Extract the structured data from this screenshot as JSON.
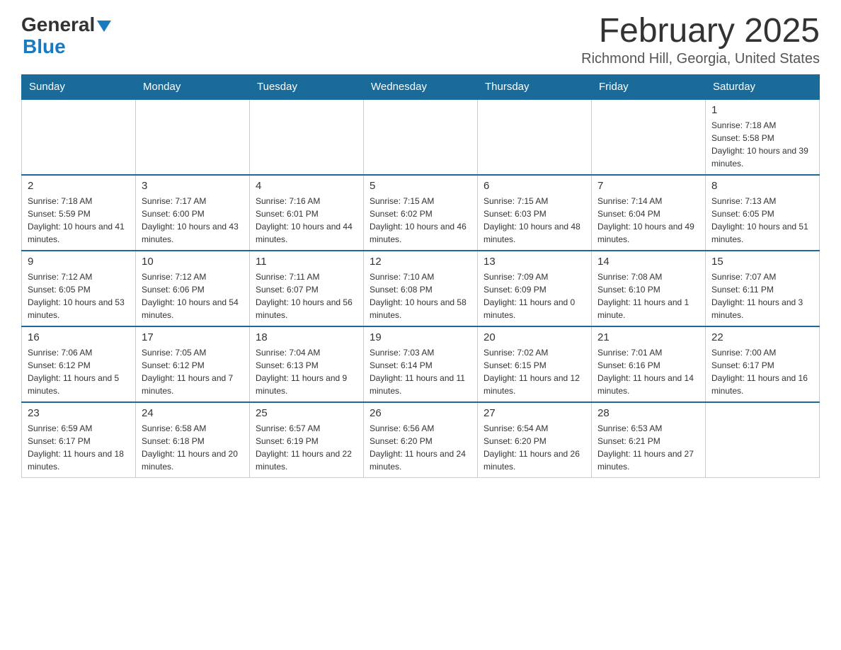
{
  "logo": {
    "general": "General",
    "blue": "Blue"
  },
  "title": {
    "month_year": "February 2025",
    "location": "Richmond Hill, Georgia, United States"
  },
  "days_of_week": [
    "Sunday",
    "Monday",
    "Tuesday",
    "Wednesday",
    "Thursday",
    "Friday",
    "Saturday"
  ],
  "weeks": [
    [
      {
        "day": "",
        "info": ""
      },
      {
        "day": "",
        "info": ""
      },
      {
        "day": "",
        "info": ""
      },
      {
        "day": "",
        "info": ""
      },
      {
        "day": "",
        "info": ""
      },
      {
        "day": "",
        "info": ""
      },
      {
        "day": "1",
        "info": "Sunrise: 7:18 AM\nSunset: 5:58 PM\nDaylight: 10 hours and 39 minutes."
      }
    ],
    [
      {
        "day": "2",
        "info": "Sunrise: 7:18 AM\nSunset: 5:59 PM\nDaylight: 10 hours and 41 minutes."
      },
      {
        "day": "3",
        "info": "Sunrise: 7:17 AM\nSunset: 6:00 PM\nDaylight: 10 hours and 43 minutes."
      },
      {
        "day": "4",
        "info": "Sunrise: 7:16 AM\nSunset: 6:01 PM\nDaylight: 10 hours and 44 minutes."
      },
      {
        "day": "5",
        "info": "Sunrise: 7:15 AM\nSunset: 6:02 PM\nDaylight: 10 hours and 46 minutes."
      },
      {
        "day": "6",
        "info": "Sunrise: 7:15 AM\nSunset: 6:03 PM\nDaylight: 10 hours and 48 minutes."
      },
      {
        "day": "7",
        "info": "Sunrise: 7:14 AM\nSunset: 6:04 PM\nDaylight: 10 hours and 49 minutes."
      },
      {
        "day": "8",
        "info": "Sunrise: 7:13 AM\nSunset: 6:05 PM\nDaylight: 10 hours and 51 minutes."
      }
    ],
    [
      {
        "day": "9",
        "info": "Sunrise: 7:12 AM\nSunset: 6:05 PM\nDaylight: 10 hours and 53 minutes."
      },
      {
        "day": "10",
        "info": "Sunrise: 7:12 AM\nSunset: 6:06 PM\nDaylight: 10 hours and 54 minutes."
      },
      {
        "day": "11",
        "info": "Sunrise: 7:11 AM\nSunset: 6:07 PM\nDaylight: 10 hours and 56 minutes."
      },
      {
        "day": "12",
        "info": "Sunrise: 7:10 AM\nSunset: 6:08 PM\nDaylight: 10 hours and 58 minutes."
      },
      {
        "day": "13",
        "info": "Sunrise: 7:09 AM\nSunset: 6:09 PM\nDaylight: 11 hours and 0 minutes."
      },
      {
        "day": "14",
        "info": "Sunrise: 7:08 AM\nSunset: 6:10 PM\nDaylight: 11 hours and 1 minute."
      },
      {
        "day": "15",
        "info": "Sunrise: 7:07 AM\nSunset: 6:11 PM\nDaylight: 11 hours and 3 minutes."
      }
    ],
    [
      {
        "day": "16",
        "info": "Sunrise: 7:06 AM\nSunset: 6:12 PM\nDaylight: 11 hours and 5 minutes."
      },
      {
        "day": "17",
        "info": "Sunrise: 7:05 AM\nSunset: 6:12 PM\nDaylight: 11 hours and 7 minutes."
      },
      {
        "day": "18",
        "info": "Sunrise: 7:04 AM\nSunset: 6:13 PM\nDaylight: 11 hours and 9 minutes."
      },
      {
        "day": "19",
        "info": "Sunrise: 7:03 AM\nSunset: 6:14 PM\nDaylight: 11 hours and 11 minutes."
      },
      {
        "day": "20",
        "info": "Sunrise: 7:02 AM\nSunset: 6:15 PM\nDaylight: 11 hours and 12 minutes."
      },
      {
        "day": "21",
        "info": "Sunrise: 7:01 AM\nSunset: 6:16 PM\nDaylight: 11 hours and 14 minutes."
      },
      {
        "day": "22",
        "info": "Sunrise: 7:00 AM\nSunset: 6:17 PM\nDaylight: 11 hours and 16 minutes."
      }
    ],
    [
      {
        "day": "23",
        "info": "Sunrise: 6:59 AM\nSunset: 6:17 PM\nDaylight: 11 hours and 18 minutes."
      },
      {
        "day": "24",
        "info": "Sunrise: 6:58 AM\nSunset: 6:18 PM\nDaylight: 11 hours and 20 minutes."
      },
      {
        "day": "25",
        "info": "Sunrise: 6:57 AM\nSunset: 6:19 PM\nDaylight: 11 hours and 22 minutes."
      },
      {
        "day": "26",
        "info": "Sunrise: 6:56 AM\nSunset: 6:20 PM\nDaylight: 11 hours and 24 minutes."
      },
      {
        "day": "27",
        "info": "Sunrise: 6:54 AM\nSunset: 6:20 PM\nDaylight: 11 hours and 26 minutes."
      },
      {
        "day": "28",
        "info": "Sunrise: 6:53 AM\nSunset: 6:21 PM\nDaylight: 11 hours and 27 minutes."
      },
      {
        "day": "",
        "info": ""
      }
    ]
  ]
}
